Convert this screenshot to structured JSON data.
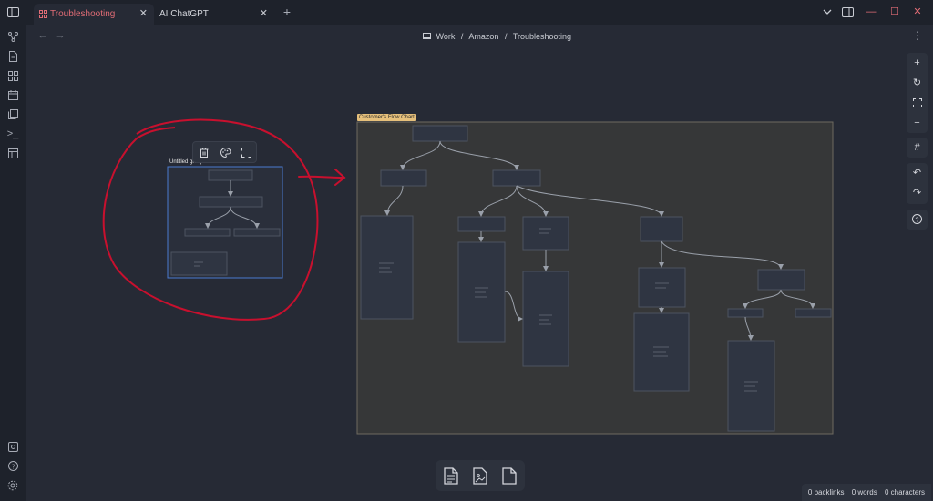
{
  "titlebar": {
    "tabs": [
      {
        "label": "Troubleshooting",
        "active": true,
        "icon": "canvas-icon"
      },
      {
        "label": "AI ChatGPT",
        "active": false
      }
    ],
    "new_tab": "+"
  },
  "breadcrumb": {
    "parts": [
      "Work",
      "/",
      "Amazon",
      "/",
      "Troubleshooting"
    ]
  },
  "canvas": {
    "group_label": "Customer's Flow Chart",
    "selected_group_label": "Untitled group"
  },
  "status": {
    "backlinks": "0 backlinks",
    "words": "0 words",
    "characters": "0 characters"
  },
  "colors": {
    "accent": "#e06c75",
    "group_label_bg": "#e6c07b",
    "annotation": "#c8102e",
    "selection": "#4a7bd0"
  }
}
